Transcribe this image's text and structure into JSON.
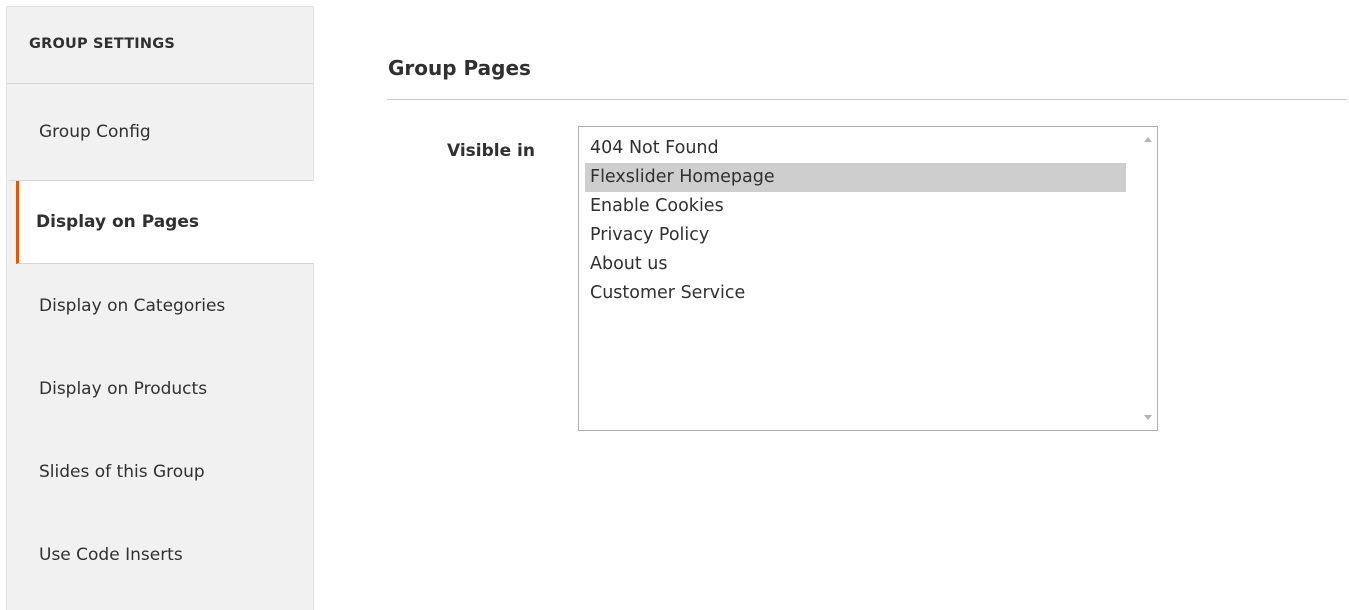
{
  "sidebar": {
    "header": "GROUP SETTINGS",
    "items": [
      {
        "label": "Group Config"
      },
      {
        "label": "Display on Pages"
      },
      {
        "label": "Display on Categories"
      },
      {
        "label": "Display on Products"
      },
      {
        "label": "Slides of this Group"
      },
      {
        "label": "Use Code Inserts"
      }
    ],
    "active_index": 1
  },
  "main": {
    "section_title": "Group Pages",
    "field": {
      "label": "Visible in",
      "options": [
        {
          "label": "404 Not Found",
          "selected": false
        },
        {
          "label": "Flexslider Homepage",
          "selected": true
        },
        {
          "label": "Enable Cookies",
          "selected": false
        },
        {
          "label": "Privacy Policy",
          "selected": false
        },
        {
          "label": "About us",
          "selected": false
        },
        {
          "label": "Customer Service",
          "selected": false
        }
      ]
    }
  },
  "colors": {
    "accent": "#eb5202",
    "sidebar_bg": "#f1f1f1",
    "selected_option_bg": "#cecece",
    "text": "#303030"
  },
  "icons": {
    "scroll_up": "scroll-up-arrow-icon",
    "scroll_down": "scroll-down-arrow-icon"
  }
}
